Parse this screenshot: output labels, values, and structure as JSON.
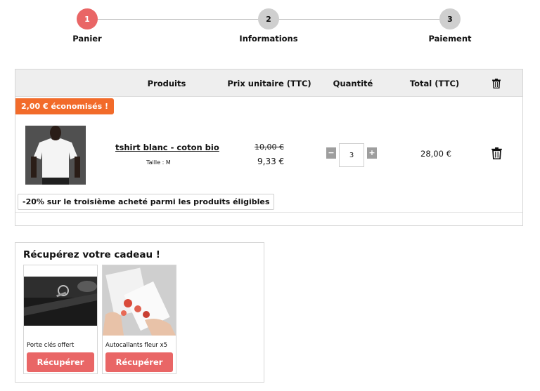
{
  "stepper": {
    "steps": [
      {
        "number": "1",
        "label": "Panier",
        "active": true
      },
      {
        "number": "2",
        "label": "Informations",
        "active": false
      },
      {
        "number": "3",
        "label": "Paiement",
        "active": false
      }
    ]
  },
  "cart": {
    "columns": {
      "products": "Produits",
      "unit_price": "Prix unitaire (TTC)",
      "quantity": "Quantité",
      "total": "Total (TTC)"
    },
    "items": [
      {
        "savings_badge": "2,00 € économisés !",
        "name": "tshirt blanc - coton bio",
        "size": "Taille : M",
        "old_price": "10,00 €",
        "price": "9,33 €",
        "quantity": "3",
        "total": "28,00 €",
        "promo": "-20% sur le troisième acheté parmi les produits éligibles"
      }
    ]
  },
  "gift": {
    "title": "Récupérez votre cadeau !",
    "items": [
      {
        "label": "Porte clés offert",
        "button": "Récupérer"
      },
      {
        "label": "Autocallants fleur x5",
        "button": "Récupérer"
      }
    ]
  },
  "colors": {
    "accent": "#e96666",
    "badge": "#f26b2a",
    "inactive_step": "#cfcfcf"
  }
}
